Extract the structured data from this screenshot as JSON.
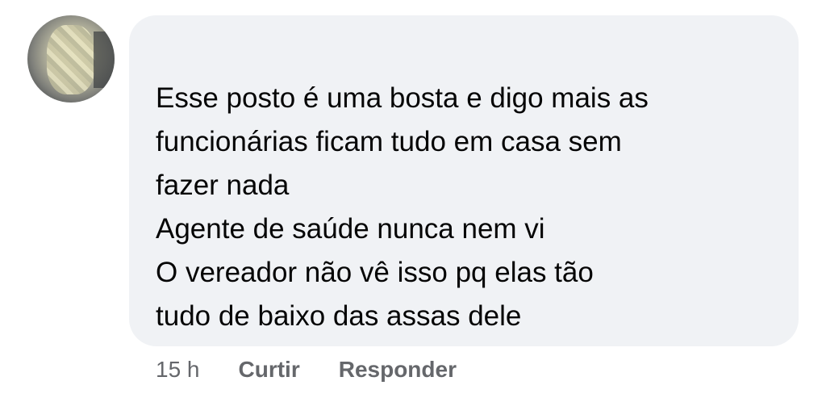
{
  "comment": {
    "text": "Esse posto é uma bosta e digo mais as\nfuncionárias ficam tudo em casa sem\nfazer nada\nAgente de saúde nunca nem vi\nO vereador não vê isso pq elas tão\ntudo de baixo das assas dele",
    "timestamp": "15 h",
    "like_label": "Curtir",
    "reply_label": "Responder"
  },
  "colors": {
    "bubble_background": "#f0f2f5",
    "text": "#050505",
    "meta_text": "#65676b"
  }
}
